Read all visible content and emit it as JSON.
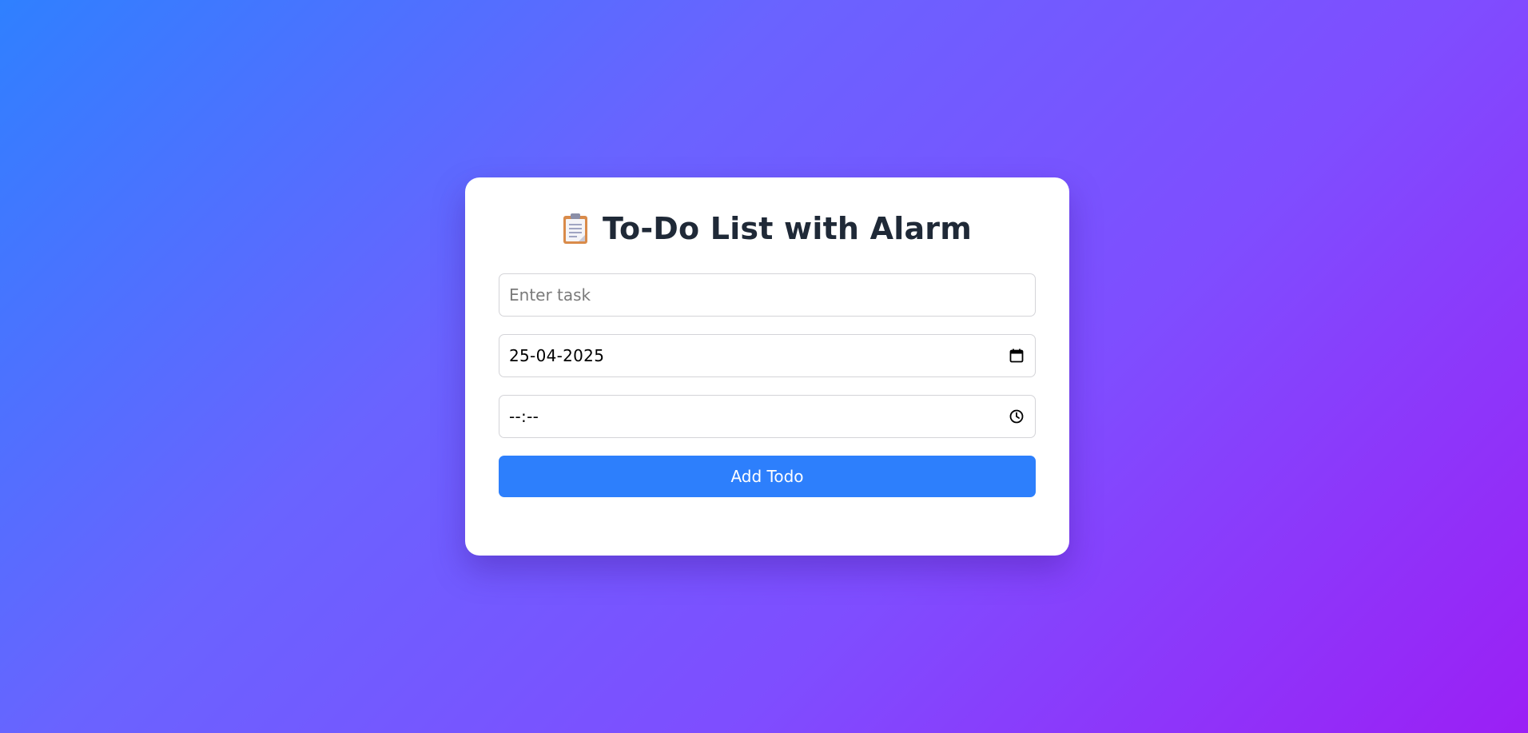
{
  "app": {
    "title": "To-Do List with Alarm",
    "title_icon": "clipboard-icon"
  },
  "form": {
    "task": {
      "value": "",
      "placeholder": "Enter task"
    },
    "date": {
      "value": "25-04-2025",
      "icon": "calendar-icon"
    },
    "time": {
      "value": "--:--",
      "icon": "clock-icon"
    },
    "add_button_label": "Add Todo"
  },
  "colors": {
    "background_start": "#2f80ff",
    "background_end": "#9b1ff5",
    "card": "#ffffff",
    "title_text": "#1f2937",
    "button": "#2d7ffc",
    "button_text": "#ffffff"
  }
}
